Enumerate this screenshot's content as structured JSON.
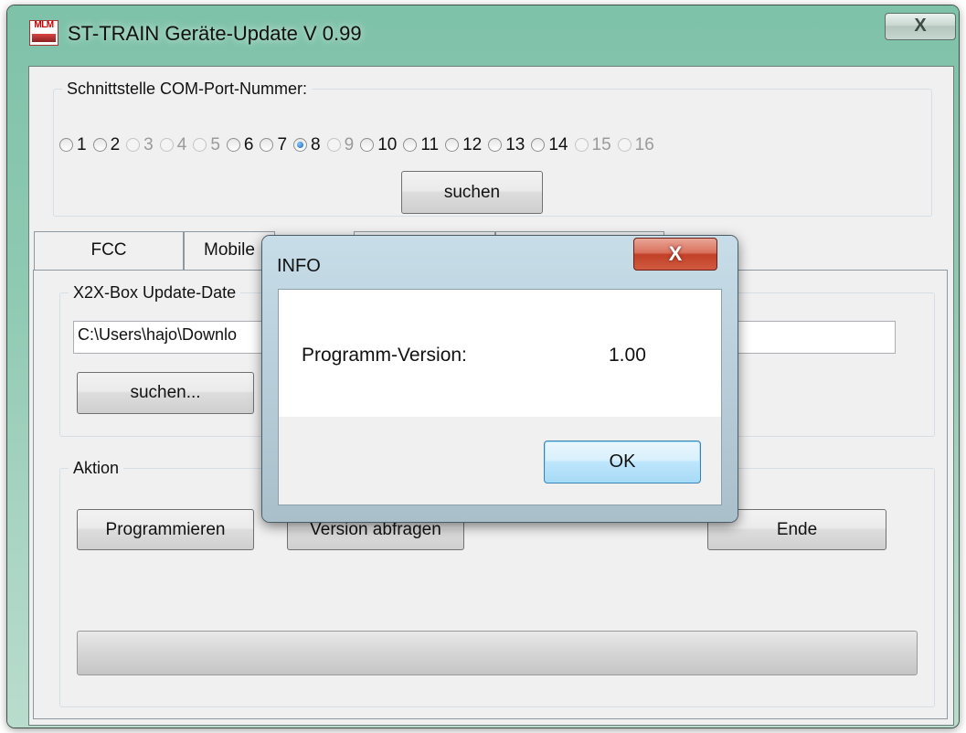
{
  "window": {
    "title": "ST-TRAIN Geräte-Update   V 0.99",
    "icon_text": "MLM",
    "close_glyph": "X"
  },
  "com_group": {
    "legend": "Schnittstelle COM-Port-Nummer:",
    "ports": [
      {
        "label": "1",
        "enabled": true,
        "selected": false
      },
      {
        "label": "2",
        "enabled": true,
        "selected": false
      },
      {
        "label": "3",
        "enabled": false,
        "selected": false
      },
      {
        "label": "4",
        "enabled": false,
        "selected": false
      },
      {
        "label": "5",
        "enabled": false,
        "selected": false
      },
      {
        "label": "6",
        "enabled": true,
        "selected": false
      },
      {
        "label": "7",
        "enabled": true,
        "selected": false
      },
      {
        "label": "8",
        "enabled": true,
        "selected": true
      },
      {
        "label": "9",
        "enabled": false,
        "selected": false
      },
      {
        "label": "10",
        "enabled": true,
        "selected": false
      },
      {
        "label": "11",
        "enabled": true,
        "selected": false
      },
      {
        "label": "12",
        "enabled": true,
        "selected": false
      },
      {
        "label": "13",
        "enabled": true,
        "selected": false
      },
      {
        "label": "14",
        "enabled": true,
        "selected": false
      },
      {
        "label": "15",
        "enabled": false,
        "selected": false
      },
      {
        "label": "16",
        "enabled": false,
        "selected": false
      }
    ],
    "search_button": "suchen"
  },
  "tabs": [
    {
      "label": "FCC"
    },
    {
      "label": "Mobile"
    },
    {
      "label": ""
    },
    {
      "label": ""
    }
  ],
  "file_group": {
    "legend": "X2X-Box Update-Date",
    "path_value": "C:\\Users\\hajo\\Downlo",
    "browse_button": "suchen..."
  },
  "action_group": {
    "legend": "Aktion",
    "program_button": "Programmieren",
    "version_button": "Version abfragen",
    "end_button": "Ende",
    "progress": 0
  },
  "dialog": {
    "title": "INFO",
    "close_glyph": "X",
    "label": "Programm-Version:",
    "value": "1.00",
    "ok_button": "OK"
  },
  "colors": {
    "title_bar": "#8fcab3",
    "dialog_close": "#c24028",
    "selected_radio": "#1e5fae"
  }
}
